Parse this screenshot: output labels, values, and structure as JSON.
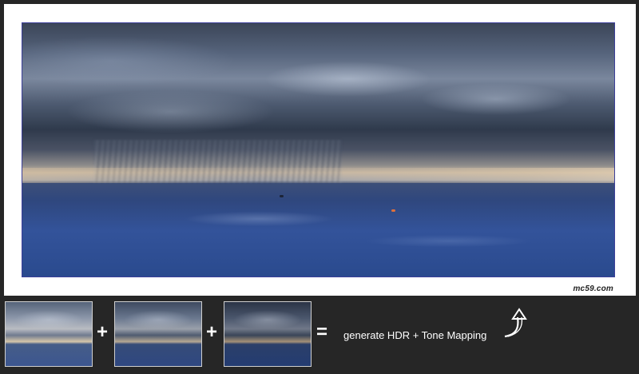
{
  "main_image": {
    "description_icon": "storm-over-sea-photo",
    "watermark": "mc59.com"
  },
  "thumbnails": [
    {
      "icon": "exposure-thumbnail-light"
    },
    {
      "icon": "exposure-thumbnail-medium"
    },
    {
      "icon": "exposure-thumbnail-dark"
    }
  ],
  "operators": {
    "plus_1": "+",
    "plus_2": "+",
    "equals": "="
  },
  "caption": "generate HDR + Tone Mapping",
  "arrow_icon": "curved-up-arrow-icon",
  "colors": {
    "background": "#262626",
    "frame": "#ffffff",
    "photo_border": "#3c3f9a",
    "text": "#ffffff"
  }
}
